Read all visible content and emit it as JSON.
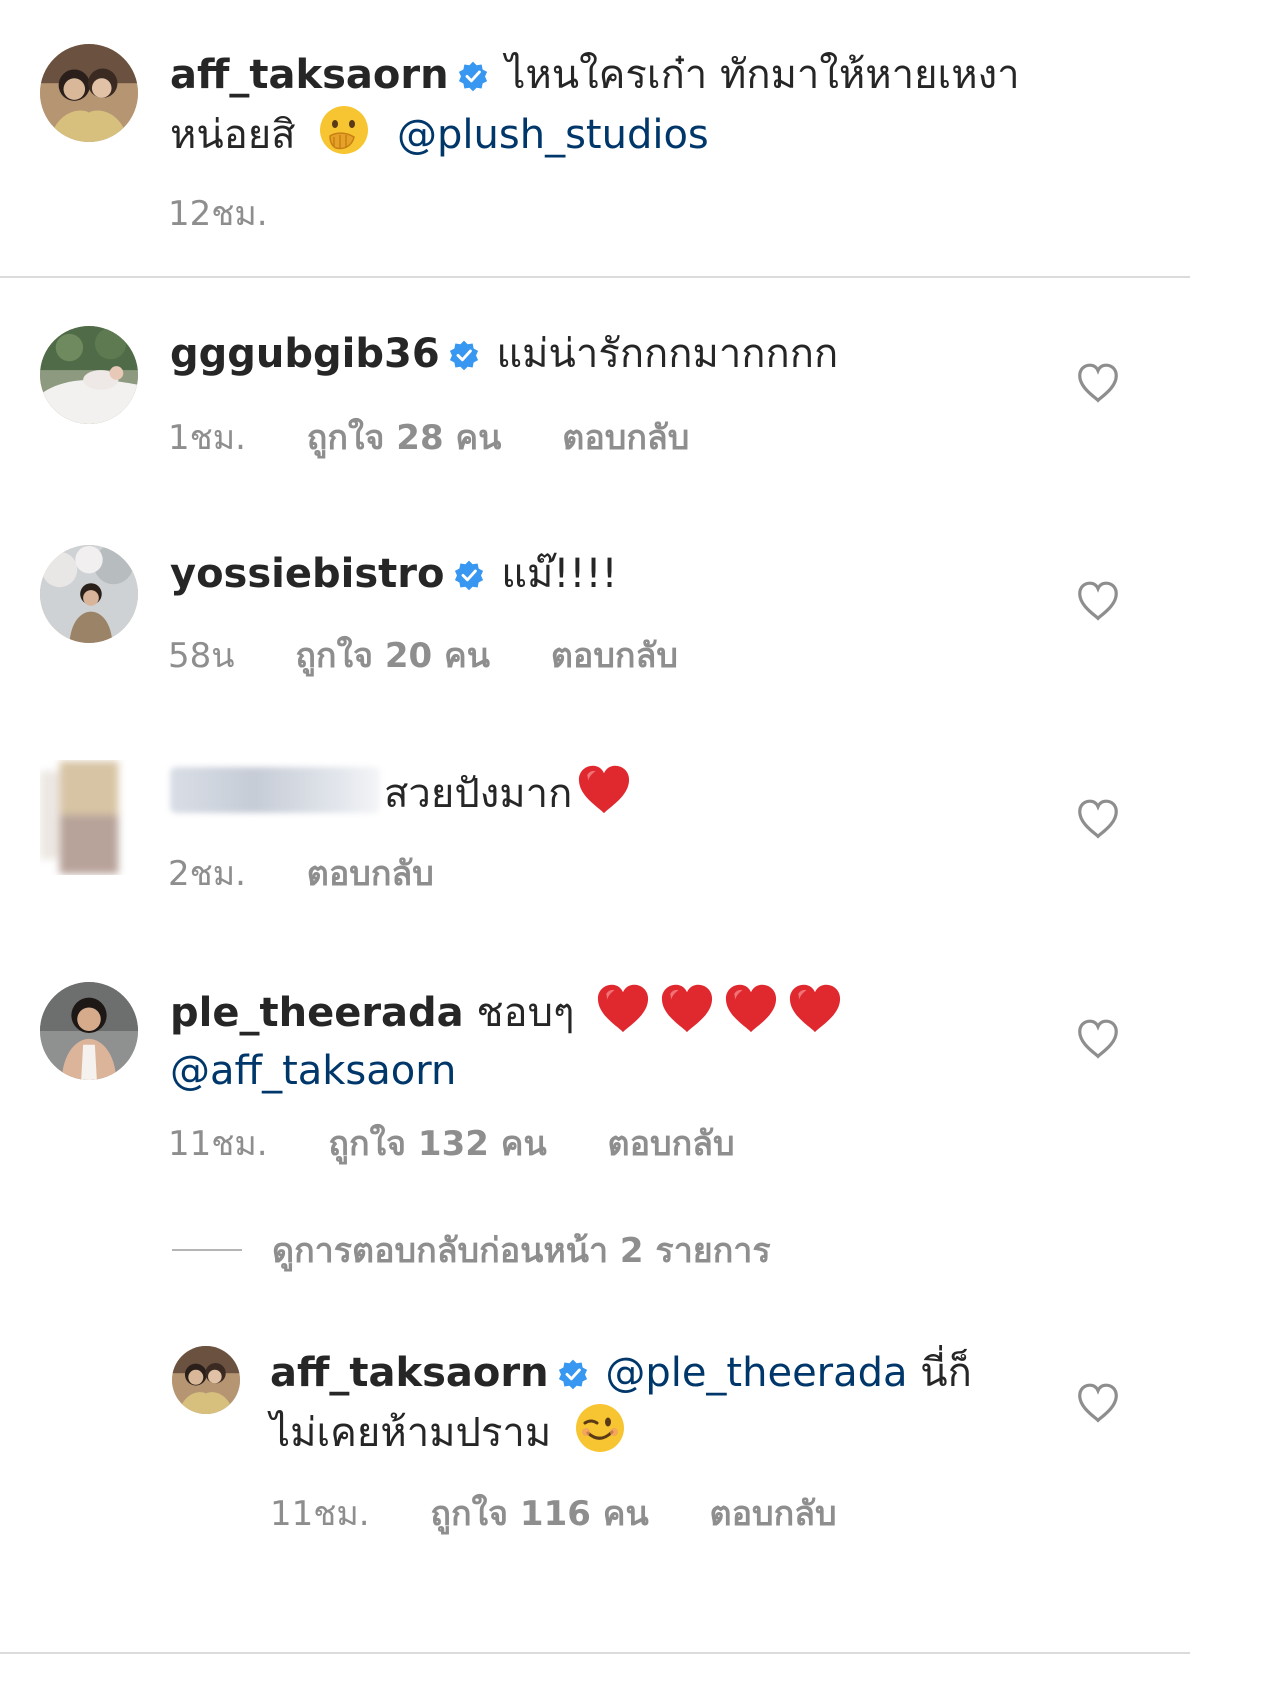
{
  "caption": {
    "username": "aff_taksaorn",
    "text_line1": "ไหนใครเก๋า ทักมาให้หายเหงา",
    "text_line2": "หน่อยสิ",
    "mention": "@plush_studios",
    "time": "12ชม."
  },
  "comments": [
    {
      "username": "gggubgib36",
      "text": "แม่น่ารักกกมากกกก",
      "time": "1ชม.",
      "likes": "ถูกใจ 28 คน",
      "reply": "ตอบกลับ"
    },
    {
      "username": "yossiebistro",
      "text": "แม๊!!!!",
      "time": "58น",
      "likes": "ถูกใจ 20 คน",
      "reply": "ตอบกลับ"
    },
    {
      "username": "",
      "text": "สวยปังมาก",
      "time": "2ชม.",
      "reply": "ตอบกลับ"
    },
    {
      "username": "ple_theerada",
      "text": "ชอบๆ",
      "mention": "@aff_taksaorn",
      "time": "11ชม.",
      "likes": "ถูกใจ 132 คน",
      "reply": "ตอบกลับ"
    }
  ],
  "view_replies": "ดูการตอบกลับก่อนหน้า 2 รายการ",
  "reply_comment": {
    "username": "aff_taksaorn",
    "mention": "@ple_theerada",
    "text_after_mention": "นี่ก็",
    "text_line2": "ไม่เคยห้ามปราม",
    "time": "11ชม.",
    "likes": "ถูกใจ 116 คน",
    "reply": "ตอบกลับ"
  },
  "colors": {
    "text": "#262626",
    "secondary": "#8e8e8e",
    "mention": "#00376b",
    "verified": "#3897f0",
    "divider": "#dbdbdb"
  }
}
